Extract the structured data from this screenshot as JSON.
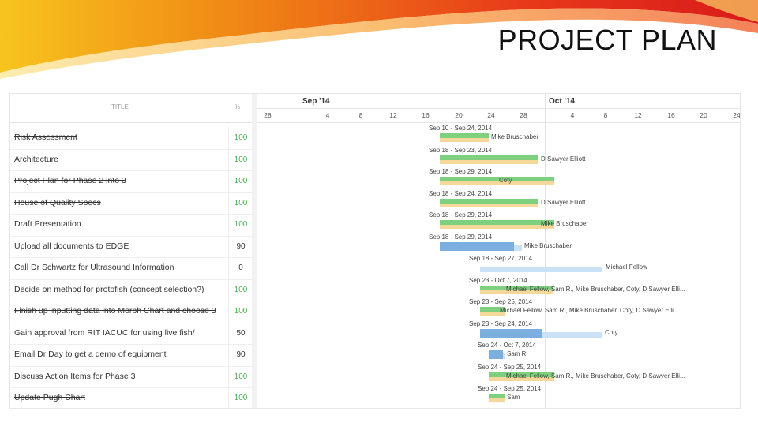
{
  "slide": {
    "title": "PROJECT PLAN"
  },
  "table": {
    "header_title": "TITLE",
    "header_pct": "%",
    "tasks": [
      {
        "title": "Risk Assessment",
        "pct": "100",
        "done": true
      },
      {
        "title": "Architecture",
        "pct": "100",
        "done": true
      },
      {
        "title": "Project Plan for Phase 2 into 3",
        "pct": "100",
        "done": true
      },
      {
        "title": "House of Quality Specs",
        "pct": "100",
        "done": true
      },
      {
        "title": "Draft Presentation",
        "pct": "100",
        "done": false
      },
      {
        "title": "Upload all documents to EDGE",
        "pct": "90",
        "done": false
      },
      {
        "title": "Call Dr Schwartz for Ultrasound Information",
        "pct": "0",
        "done": false
      },
      {
        "title": "Decide on method for protofish (concept selection?)",
        "pct": "100",
        "done": false
      },
      {
        "title": "Finish up inputting data into Morph Chart and choose 3",
        "pct": "100",
        "done": true
      },
      {
        "title": "Gain approval from RIT IACUC for using live fish/",
        "pct": "50",
        "done": false
      },
      {
        "title": "Email Dr Day to get a demo of equipment",
        "pct": "90",
        "done": false
      },
      {
        "title": "Discuss Action Items for Phase 3",
        "pct": "100",
        "done": true
      },
      {
        "title": "Update Pugh Chart",
        "pct": "100",
        "done": true
      }
    ]
  },
  "timeline": {
    "months": [
      {
        "label": "Sep '14"
      },
      {
        "label": "Oct '14"
      }
    ],
    "days": [
      "28",
      "4",
      "8",
      "12",
      "16",
      "20",
      "24",
      "28",
      "4",
      "8",
      "12",
      "16",
      "20",
      "24"
    ],
    "bars": [
      {
        "range": "Sep 10 - Sep 24, 2014",
        "assignee": "Mike Bruschaber",
        "color": "green",
        "progress": 1.0
      },
      {
        "range": "Sep 18 - Sep 23, 2014",
        "assignee": "D Sawyer Elliott",
        "color": "green",
        "progress": 1.0
      },
      {
        "range": "Sep 18 - Sep 29, 2014",
        "assignee": "Coty",
        "color": "green",
        "progress": 1.0
      },
      {
        "range": "Sep 18 - Sep 24, 2014",
        "assignee": "D Sawyer Elliott",
        "color": "green",
        "progress": 1.0
      },
      {
        "range": "Sep 18 - Sep 29, 2014",
        "assignee": "Mike Bruschaber",
        "color": "green",
        "progress": 1.0
      },
      {
        "range": "Sep 18 - Sep 29, 2014",
        "assignee": "Mike Bruschaber",
        "color": "blue",
        "progress": 0.9
      },
      {
        "range": "Sep 18 - Sep 27, 2014",
        "assignee": "Michael Fellow",
        "color": "blue",
        "progress": 0.0
      },
      {
        "range": "Sep 23 - Oct 7, 2014",
        "assignee": "Michael Fellow, Sam R., Mike Bruschaber, Coty, D Sawyer Elli...",
        "color": "green",
        "progress": 1.0
      },
      {
        "range": "Sep 23 - Sep 25, 2014",
        "assignee": "Michael Fellow, Sam R., Mike Bruschaber, Coty, D Sawyer Elli...",
        "color": "green",
        "progress": 1.0
      },
      {
        "range": "Sep 23 - Sep 24, 2014",
        "assignee": "Coty",
        "color": "blue",
        "progress": 0.5
      },
      {
        "range": "Sep 24 - Oct 7, 2014",
        "assignee": "Sam R.",
        "color": "blue",
        "progress": 0.9
      },
      {
        "range": "Sep 24 - Sep 25, 2014",
        "assignee": "Michael Fellow, Sam R., Mike Bruschaber, Coty, D Sawyer Elli...",
        "color": "green",
        "progress": 1.0
      },
      {
        "range": "Sep 24 - Sep 25, 2014",
        "assignee": "Sam",
        "color": "green",
        "progress": 1.0
      }
    ]
  }
}
